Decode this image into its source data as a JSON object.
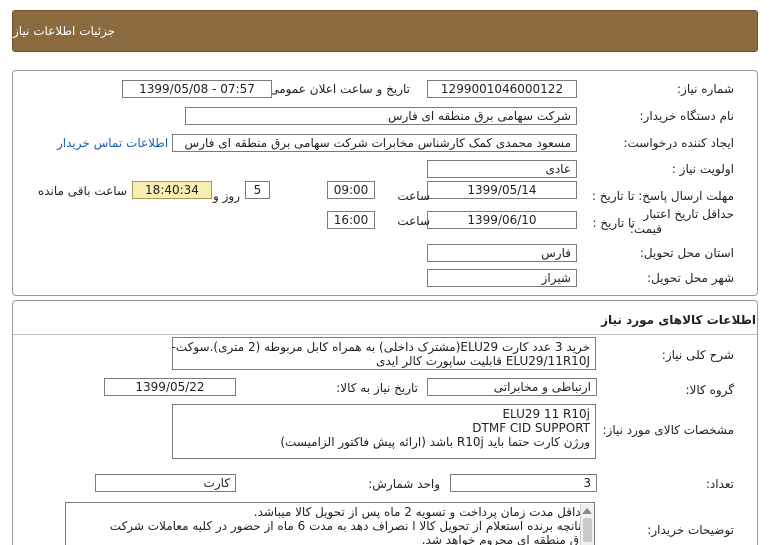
{
  "header": {
    "title": "جزئیات اطلاعات نیاز"
  },
  "need": {
    "need_number_label": "شماره نیاز:",
    "need_number": "1299001046000122",
    "announce_label": "تاریخ و ساعت اعلان عمومی:",
    "announce_value": "1399/05/08 - 07:57",
    "buyer_label": "نام دستگاه خریدار:",
    "buyer": "شرکت سهامی برق منطقه ای فارس",
    "creator_label": "ایجاد کننده درخواست:",
    "creator": "مسعود محمدی کمک کارشناس مخابرات شرکت سهامی برق منطقه ای فارس",
    "contact_link": "اطلاعات تماس خریدار",
    "priority_label": "اولویت نیاز :",
    "priority": "عادی",
    "reply_deadline_label": "مهلت ارسال پاسخ: تا تاریخ :",
    "reply_date": "1399/05/14",
    "time_label": "ساعت",
    "reply_time": "09:00",
    "days_value": "5",
    "days_label": "روز و",
    "remaining_time": "18:40:34",
    "remaining_label": "ساعت باقی مانده",
    "validity_label_line1": "حداقل تاریخ اعتبار",
    "validity_label_line2": "قیمت:",
    "until_date_label": "تا تاریخ :",
    "validity_date": "1399/06/10",
    "validity_time": "16:00",
    "province_label": "استان محل تحویل:",
    "province": "فارس",
    "city_label": "شهر محل تحویل:",
    "city": "شیراز"
  },
  "goods": {
    "section_title": "اطلاعات کالاهای مورد نیاز",
    "summary_label": "شرح کلی نیاز:",
    "summary_line1": "خرید 3 عدد کارت ELU29(مشترک داخلی) به همراه کابل مربوطه (2 متری).سوکت-",
    "summary_line2": "ELU29/11R10J قابلیت ساپورت کالر ایدی",
    "group_label": "گروه کالا:",
    "group": "ارتباطی و مخابراتی",
    "need_date_label": "تاریخ نیاز به کالا:",
    "need_date": "1399/05/22",
    "spec_label": "مشخصات کالای مورد نیاز:",
    "spec_line1": "ELU29  11  R10j",
    "spec_line2": "DTMF  CID  SUPPORT",
    "spec_line3": "ورژن کارت حتما باید  R10j باشد (ارائه پیش فاکتور الزامیست)",
    "quantity_label": "تعداد:",
    "quantity": "3",
    "unit_label": "واحد شمارش:",
    "unit": "کارت",
    "buyer_notes_label": "توضیحات خریدار:",
    "notes_line1": "حداقل مدت زمان پرداخت و تسویه 2 ماه پس از تحویل کالا میباشد.",
    "notes_line2": "چنانچه برنده استعلام از تحویل کالا ا نصراف دهد به مدت 6 ماه از حضور در کلیه معاملات شرکت",
    "notes_line3": "برق منطقه ای محروم خواهد شد."
  },
  "colors": {
    "header_bg": "#8b6a3e",
    "remaining_bg": "#f7eeb0",
    "link": "#1a5fb4"
  }
}
